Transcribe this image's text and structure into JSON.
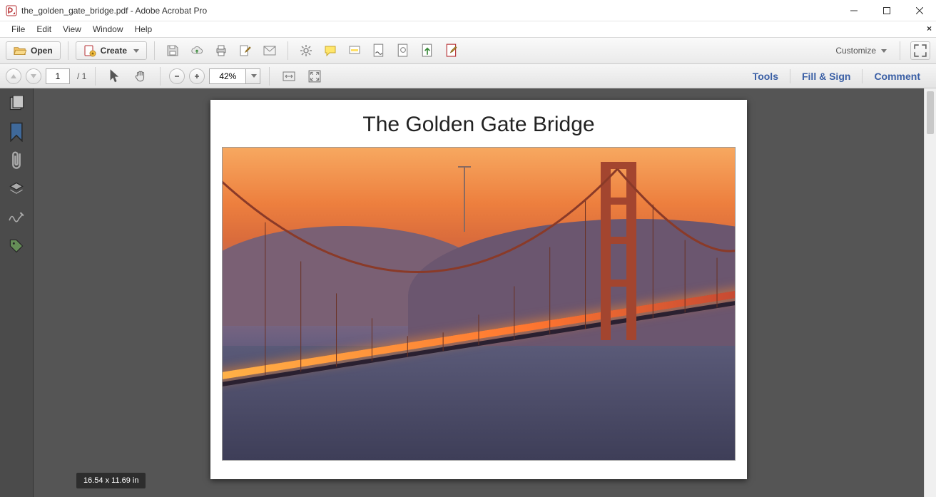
{
  "window": {
    "title": "the_golden_gate_bridge.pdf - Adobe Acrobat Pro"
  },
  "menubar": {
    "items": [
      "File",
      "Edit",
      "View",
      "Window",
      "Help"
    ]
  },
  "toolbar": {
    "open_label": "Open",
    "create_label": "Create",
    "customize_label": "Customize"
  },
  "navbar": {
    "page_current": "1",
    "page_total": "/ 1",
    "zoom_value": "42%",
    "links": {
      "tools": "Tools",
      "fill_sign": "Fill & Sign",
      "comment": "Comment"
    }
  },
  "document": {
    "heading": "The Golden Gate Bridge"
  },
  "status": {
    "dimensions": "16.54 x 11.69 in"
  }
}
